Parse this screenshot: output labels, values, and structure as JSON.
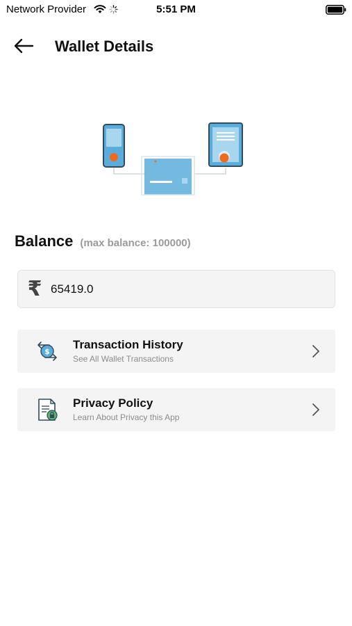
{
  "status_bar": {
    "carrier": "Network Provider",
    "time": "5:51 PM"
  },
  "header": {
    "title": "Wallet Details"
  },
  "balance": {
    "label": "Balance",
    "note": "(max balance: 100000)",
    "currency_symbol": "₹",
    "value": "65419.0"
  },
  "menu": [
    {
      "title": "Transaction History",
      "subtitle": "See All Wallet Transactions",
      "icon": "transaction-exchange-icon"
    },
    {
      "title": "Privacy Policy",
      "subtitle": "Learn About Privacy this App",
      "icon": "privacy-document-lock-icon"
    }
  ],
  "colors": {
    "accent_blue": "#5aaddb",
    "accent_orange": "#ef6a1b",
    "card_bg": "#f4f4f4",
    "muted_text": "#8c8c8c"
  }
}
